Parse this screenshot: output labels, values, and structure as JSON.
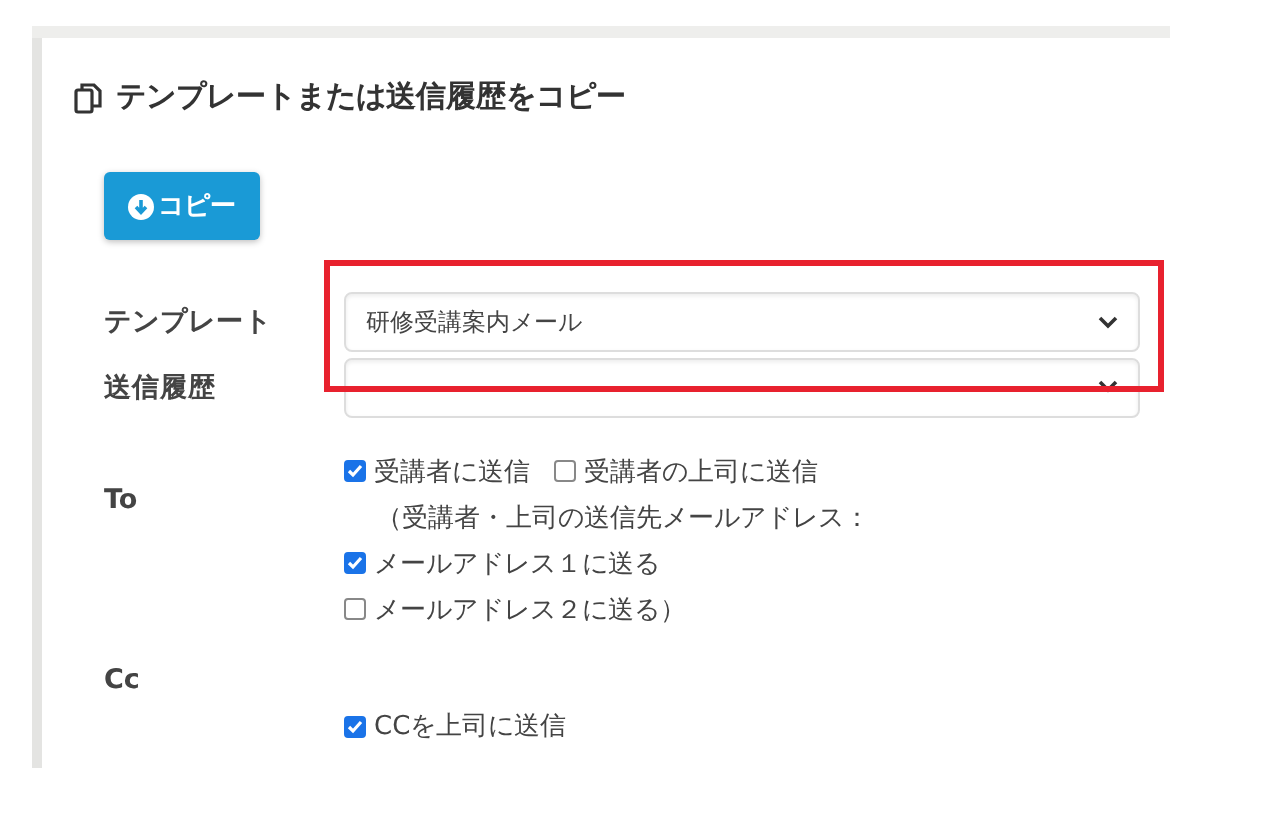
{
  "panel": {
    "title": "テンプレートまたは送信履歴をコピー"
  },
  "copy_button": {
    "label": "コピー"
  },
  "fields": [
    {
      "label": "テンプレート",
      "value": "研修受講案内メール",
      "highlighted": true
    },
    {
      "label": "送信履歴",
      "highlighted": false
    }
  ],
  "to": {
    "label": "To",
    "lines": [
      [
        {
          "kind": "checkbox",
          "label": "受講者に送信",
          "checked": true
        },
        {
          "kind": "checkbox",
          "label": "受講者の上司に送信",
          "checked": false
        }
      ],
      [
        {
          "kind": "note",
          "label": "（受講者・上司の送信先メールアドレス："
        }
      ],
      [
        {
          "kind": "checkbox",
          "label": "メールアドレス１に送る",
          "checked": true
        }
      ],
      [
        {
          "kind": "checkbox",
          "label": "メールアドレス２に送る）",
          "checked": false
        }
      ]
    ]
  },
  "cc": {
    "label": "Cc",
    "options": [
      {
        "label": "CCを上司に送信",
        "checked": true
      }
    ]
  }
}
